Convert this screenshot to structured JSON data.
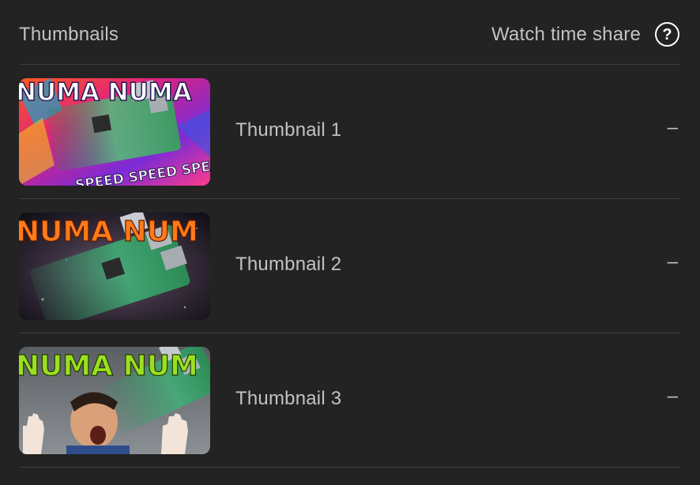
{
  "header": {
    "title": "Thumbnails",
    "metric_label": "Watch time share",
    "help_icon": "help-circle-icon"
  },
  "rows": [
    {
      "label": "Thumbnail 1",
      "value": "–",
      "thumb_text_top": "NUMA NUMA",
      "thumb_text_bottom": "SPEED SPEED SPEE"
    },
    {
      "label": "Thumbnail 2",
      "value": "–",
      "thumb_text_top": "NUMA NUM"
    },
    {
      "label": "Thumbnail 3",
      "value": "–",
      "thumb_text_top": "NUMA NUM"
    }
  ],
  "colors": {
    "background": "#232323",
    "divider": "#3e3e3e",
    "text": "#c2c2c2"
  }
}
